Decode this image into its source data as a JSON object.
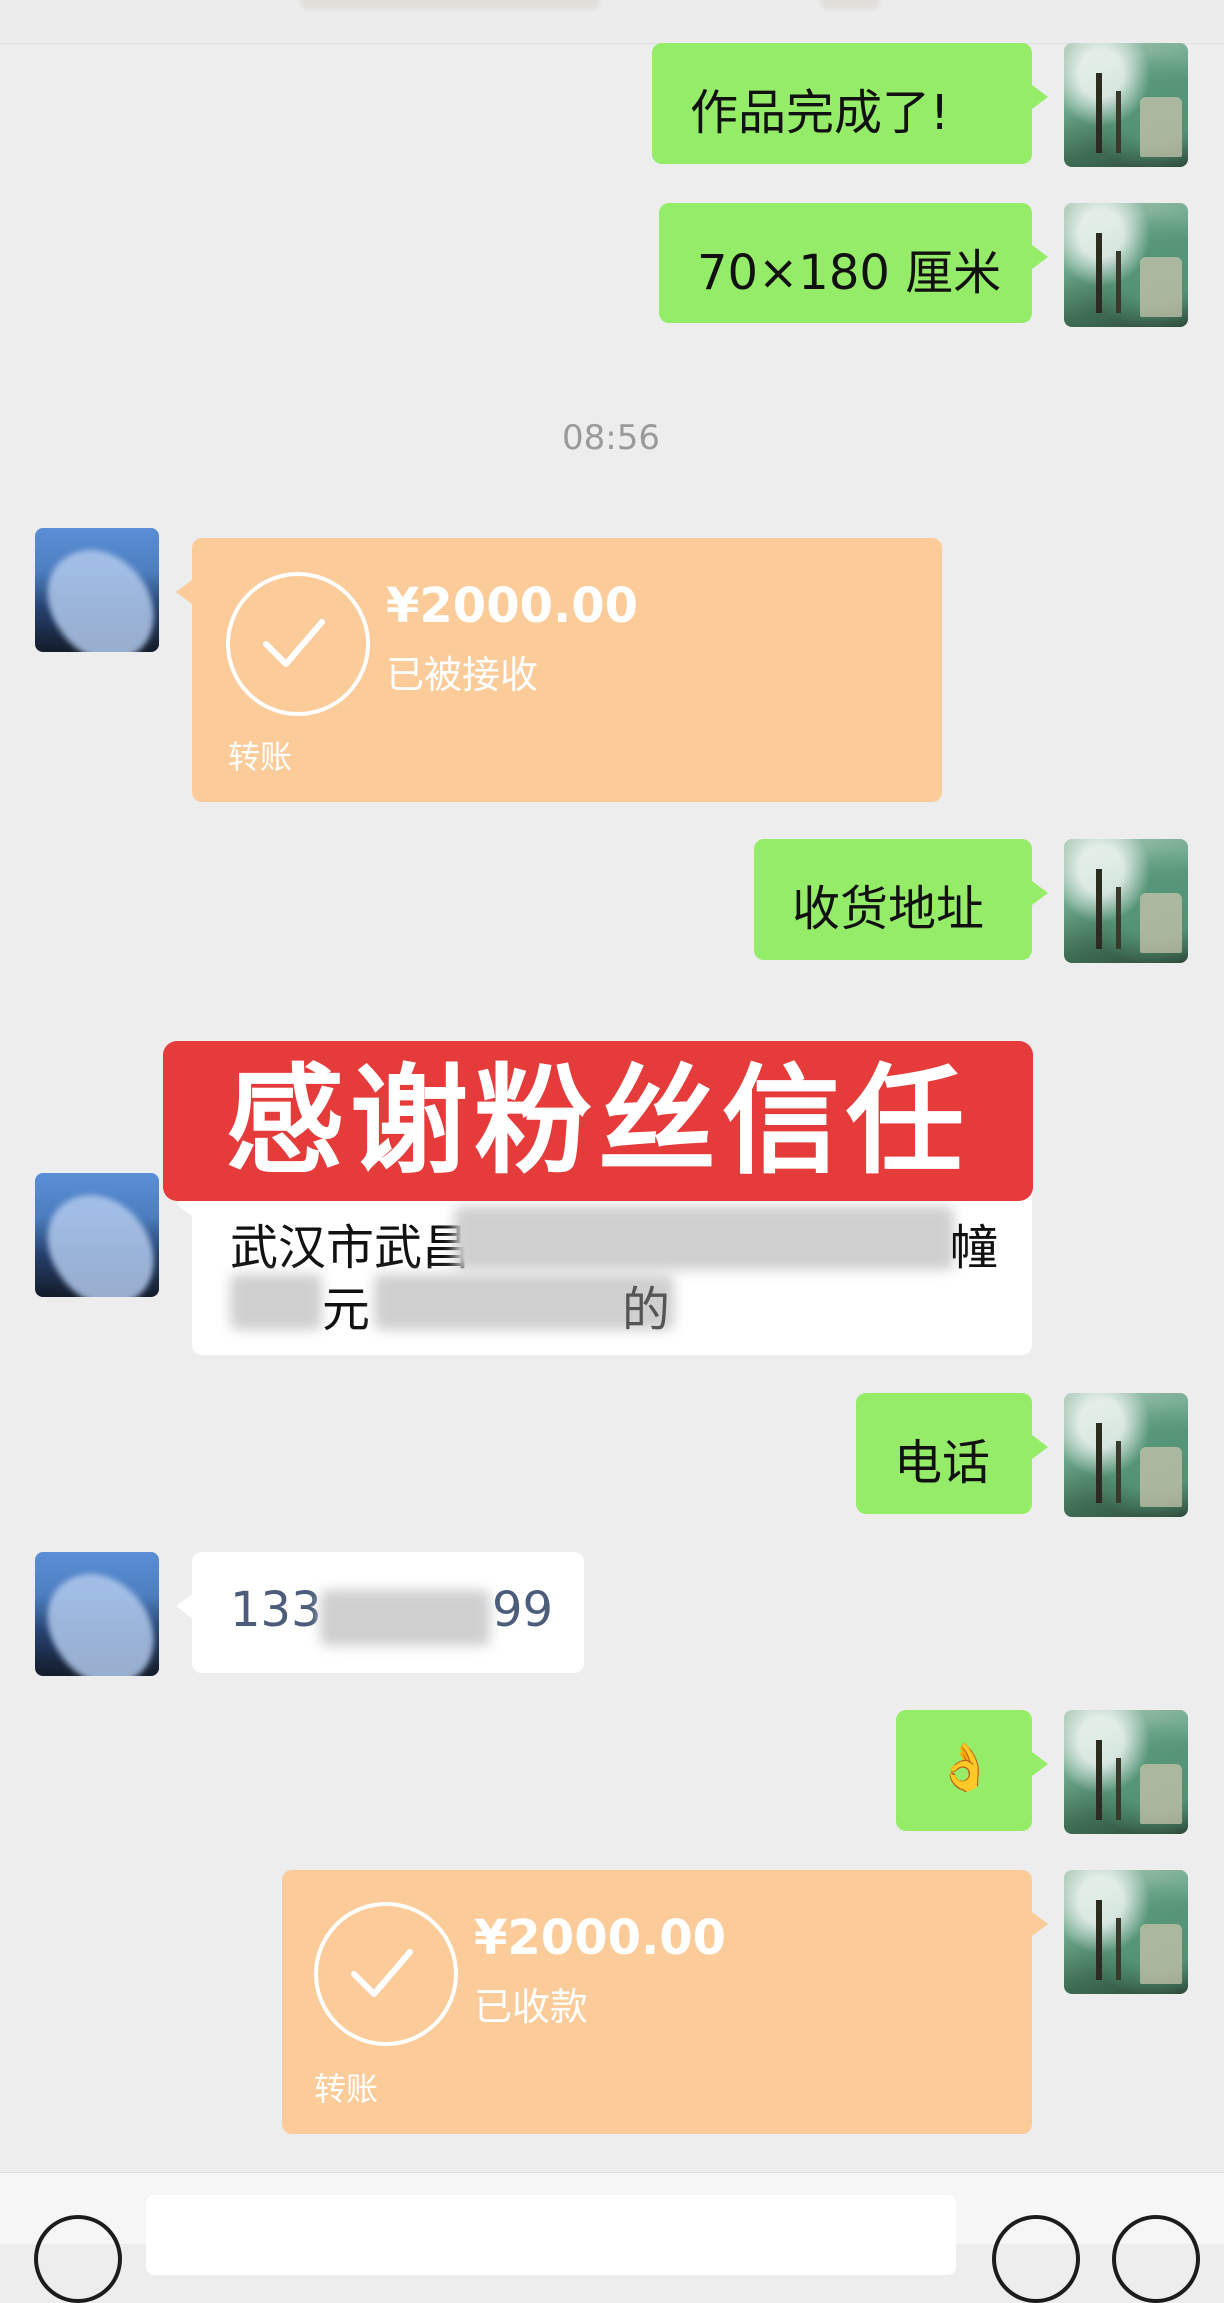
{
  "messages": {
    "m1": "作品完成了!",
    "m2": "70×180 厘米",
    "time": "08:56",
    "transfer1": {
      "amount": "¥2000.00",
      "status": "已被接收",
      "label": "转账"
    },
    "m3": "收货地址",
    "address": {
      "line1_start": "武汉市武昌",
      "line1_end": "幢",
      "line2": "元",
      "line2_end": "的"
    },
    "m4": "电话",
    "phone": {
      "start": "133",
      "end": "99"
    },
    "m5": "👌",
    "transfer2": {
      "amount": "¥2000.00",
      "status": "已收款",
      "label": "转账"
    }
  },
  "banner": "感谢粉丝信任",
  "colors": {
    "bg": "#ededed",
    "green_bubble": "#95ec69",
    "transfer": "#fbcc99",
    "banner": "#e63b3b"
  },
  "icons": [
    "voice-icon",
    "emoji-icon",
    "plus-icon",
    "check-icon"
  ]
}
